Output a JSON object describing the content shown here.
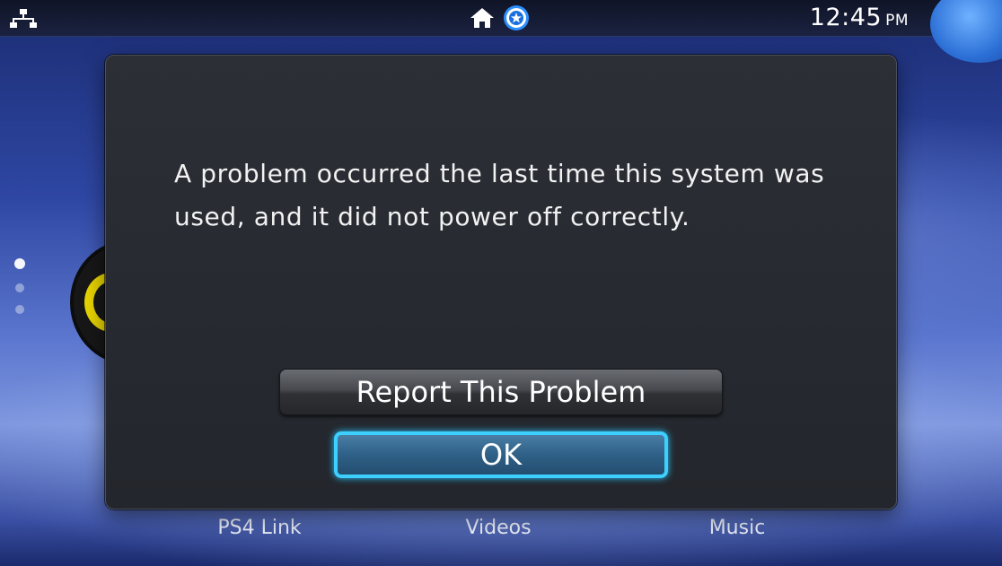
{
  "status_bar": {
    "time": "12:45",
    "ampm": "PM",
    "icons": [
      "network-icon",
      "home-icon",
      "playstation-plus-icon"
    ]
  },
  "dialog": {
    "message": "A problem occurred the last time this system was\nused, and it did not power off correctly.",
    "report_button": "Report This Problem",
    "ok_button": "OK"
  },
  "home_screen": {
    "labels": [
      "PS4 Link",
      "Videos",
      "Music"
    ],
    "page_count": 3,
    "active_page": 1
  },
  "colors": {
    "focus_highlight": "#3dd0ff",
    "dialog_bg": "#26292f"
  }
}
